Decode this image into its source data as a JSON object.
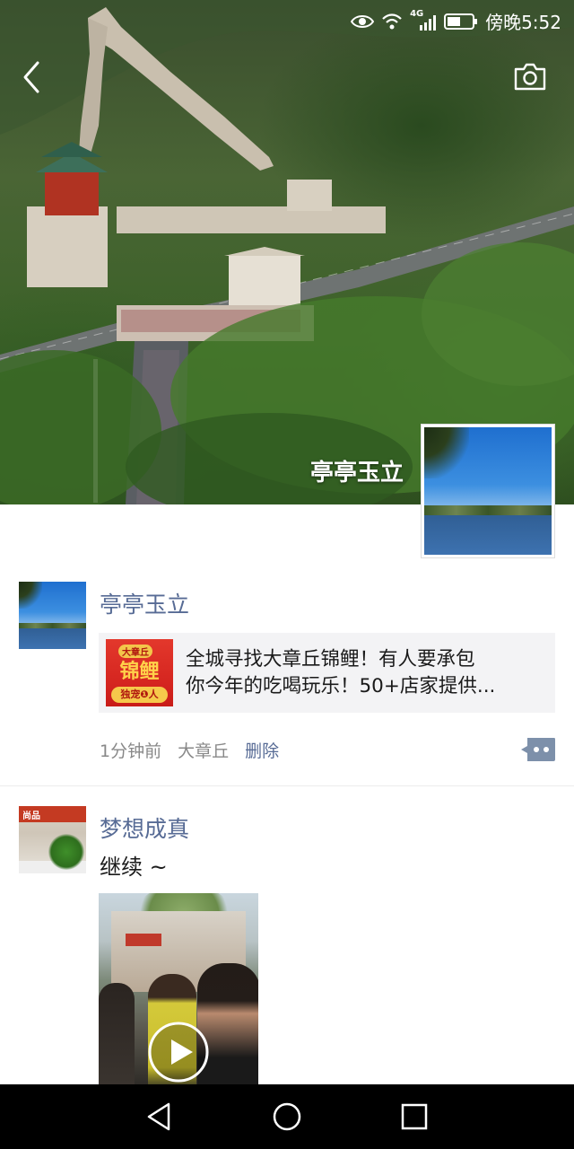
{
  "status_bar": {
    "network": "4G",
    "time": "傍晚5:52",
    "icons": [
      "eye-icon",
      "wifi-icon",
      "signal-icon",
      "battery-icon"
    ]
  },
  "header": {
    "back_icon": "chevron-left-icon",
    "camera_icon": "camera-icon"
  },
  "cover": {
    "username": "亭亭玉立",
    "image": "great-wall-cover"
  },
  "posts": [
    {
      "name": "亭亭玉立",
      "link": {
        "thumb_top": "大章丘",
        "thumb_main": "锦鲤",
        "thumb_bottom": "独宠❶人",
        "line1": "全城寻找大章丘锦鲤！有人要承包",
        "line2": "你今年的吃喝玩乐！50+店家提供..."
      },
      "time": "1分钟前",
      "location": "大章丘",
      "delete_label": "删除",
      "comment_icon": "comment-dots-icon"
    },
    {
      "name": "梦想成真",
      "avatar_sign": "尚品",
      "text": "继续 ~",
      "video_icon": "play-icon"
    }
  ],
  "navbar": {
    "icons": [
      "back-triangle-icon",
      "home-circle-icon",
      "recent-square-icon"
    ]
  },
  "colors": {
    "link_name": "#576b95",
    "meta_gray": "#888888",
    "card_bg": "#f3f3f5",
    "navbar": "#000000"
  }
}
